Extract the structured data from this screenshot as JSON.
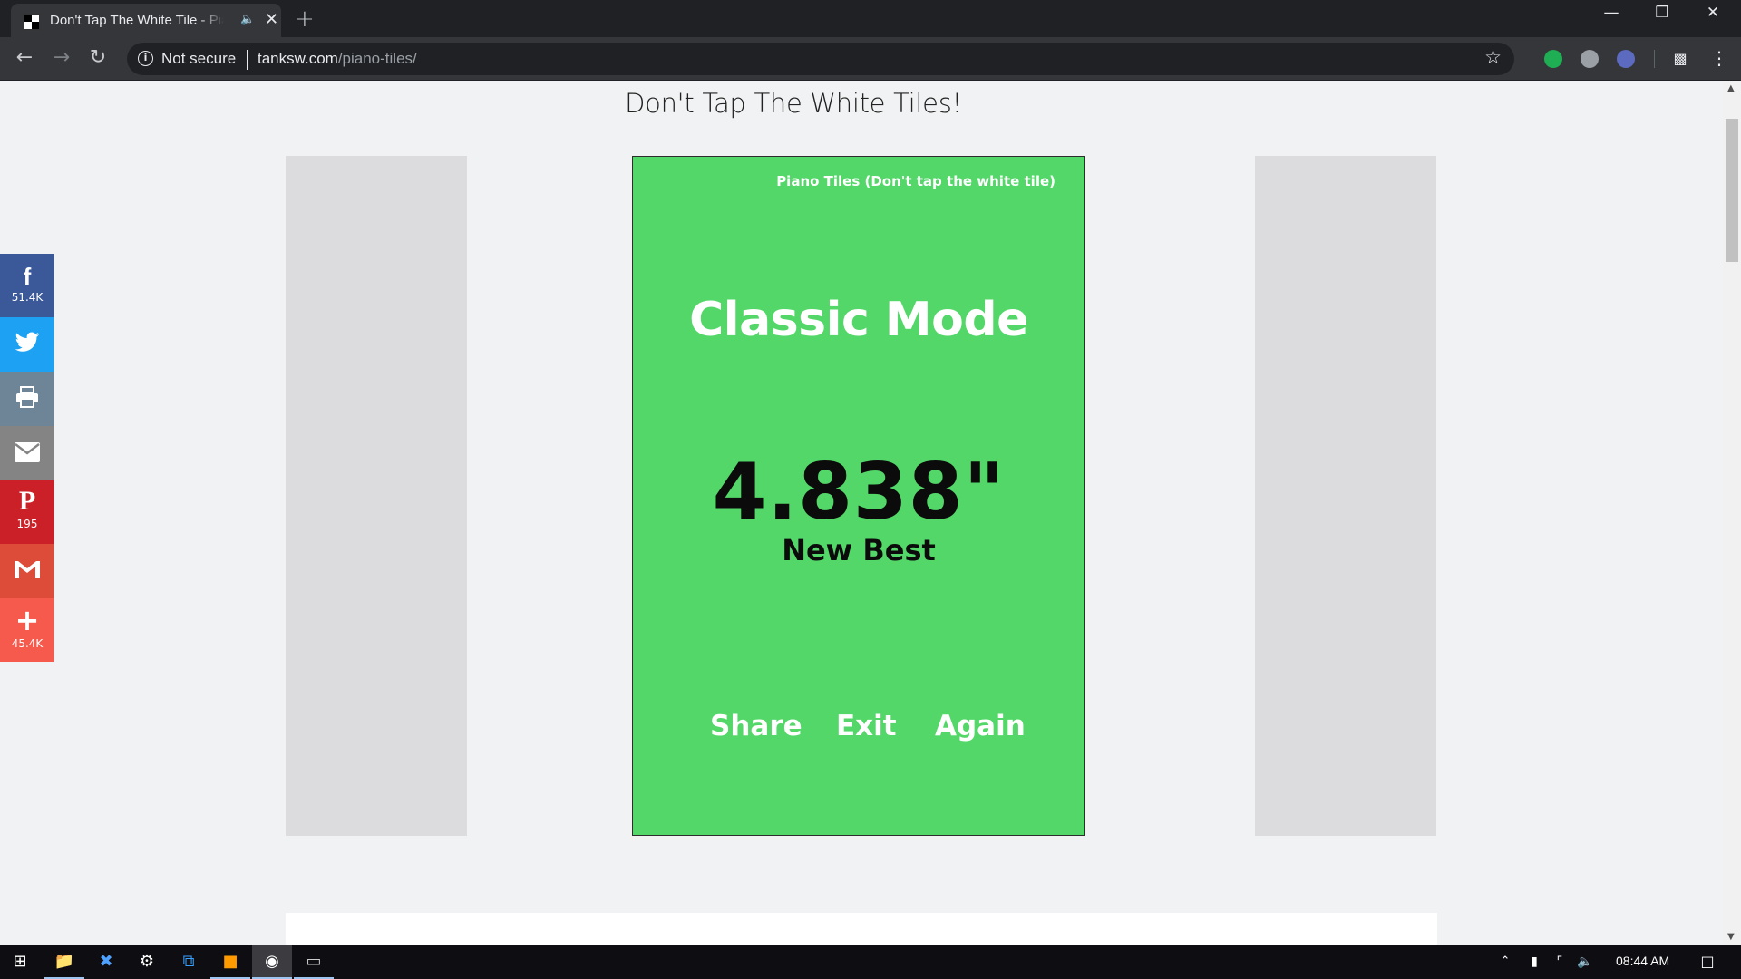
{
  "browser": {
    "tab_title": "Don't Tap The White Tile - Piano Tiles",
    "security_label": "Not secure",
    "url_host": "tanksw.com",
    "url_path": "/piano-tiles/"
  },
  "page": {
    "title": "Don't Tap The White Tiles!"
  },
  "game": {
    "header": "Piano Tiles (Don't tap the white tile)",
    "mode": "Classic Mode",
    "score": "4.838\"",
    "score_label": "New Best",
    "buttons": {
      "share": "Share",
      "exit": "Exit",
      "again": "Again"
    },
    "background_color": "#53d769"
  },
  "share_bar": {
    "facebook": {
      "icon": "facebook-icon",
      "count": "51.4K",
      "color": "#3b5998"
    },
    "twitter": {
      "icon": "twitter-icon",
      "color": "#1da1f2"
    },
    "print": {
      "icon": "print-icon",
      "color": "#6d8596"
    },
    "email": {
      "icon": "email-icon",
      "color": "#848484"
    },
    "pinterest": {
      "icon": "pinterest-icon",
      "count": "195",
      "color": "#cb2027"
    },
    "gmail": {
      "icon": "gmail-icon",
      "color": "#dd4b39"
    },
    "more": {
      "icon": "plus-icon",
      "count": "45.4K",
      "color": "#f65a4c"
    }
  },
  "taskbar": {
    "time": "08:44 AM"
  }
}
